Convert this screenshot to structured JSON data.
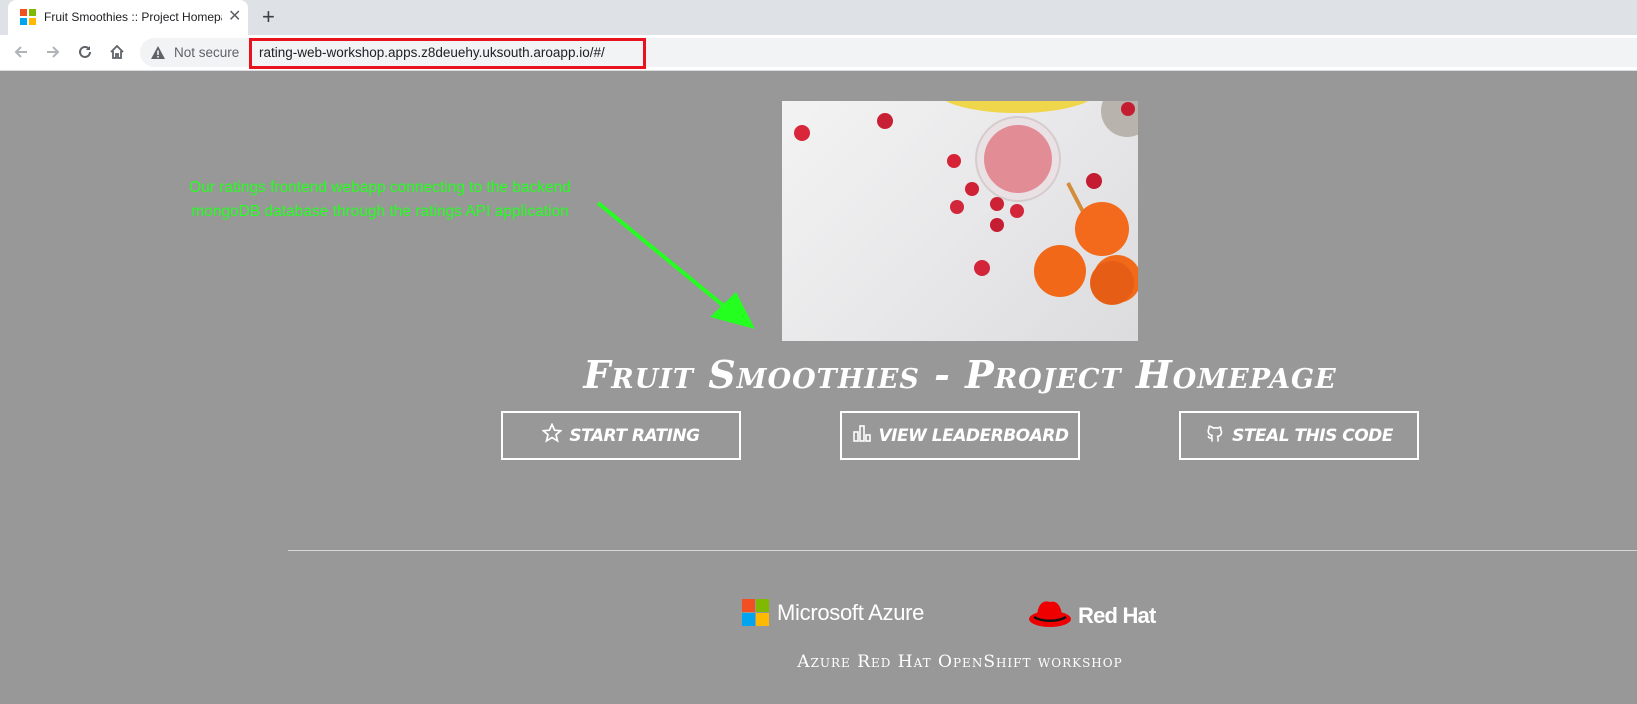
{
  "browser": {
    "tab_title": "Fruit Smoothies :: Project Homepage",
    "close_glyph": "✕",
    "new_tab_glyph": "+",
    "security_label": "Not secure",
    "url": "rating-web-workshop.apps.z8deuehy.uksouth.aroapp.io/#/",
    "url_highlight_color": "#e8131c"
  },
  "annotation": {
    "text_line1": "Our ratings frontend webapp connecting to the backend",
    "text_line2": "mongoDB database through the ratings API application",
    "color": "#24ff1f"
  },
  "page": {
    "background": "#989898",
    "title": "Fruit Smoothies - Project Homepage",
    "buttons": [
      {
        "label": "Start Rating",
        "icon": "star-icon"
      },
      {
        "label": "View Leaderboard",
        "icon": "bar-chart-icon"
      },
      {
        "label": "Steal this code",
        "icon": "github-icon"
      }
    ]
  },
  "footer": {
    "microsoft_label": "Microsoft Azure",
    "redhat_label": "Red Hat",
    "workshop_text": "Azure Red Hat OpenShift workshop"
  }
}
